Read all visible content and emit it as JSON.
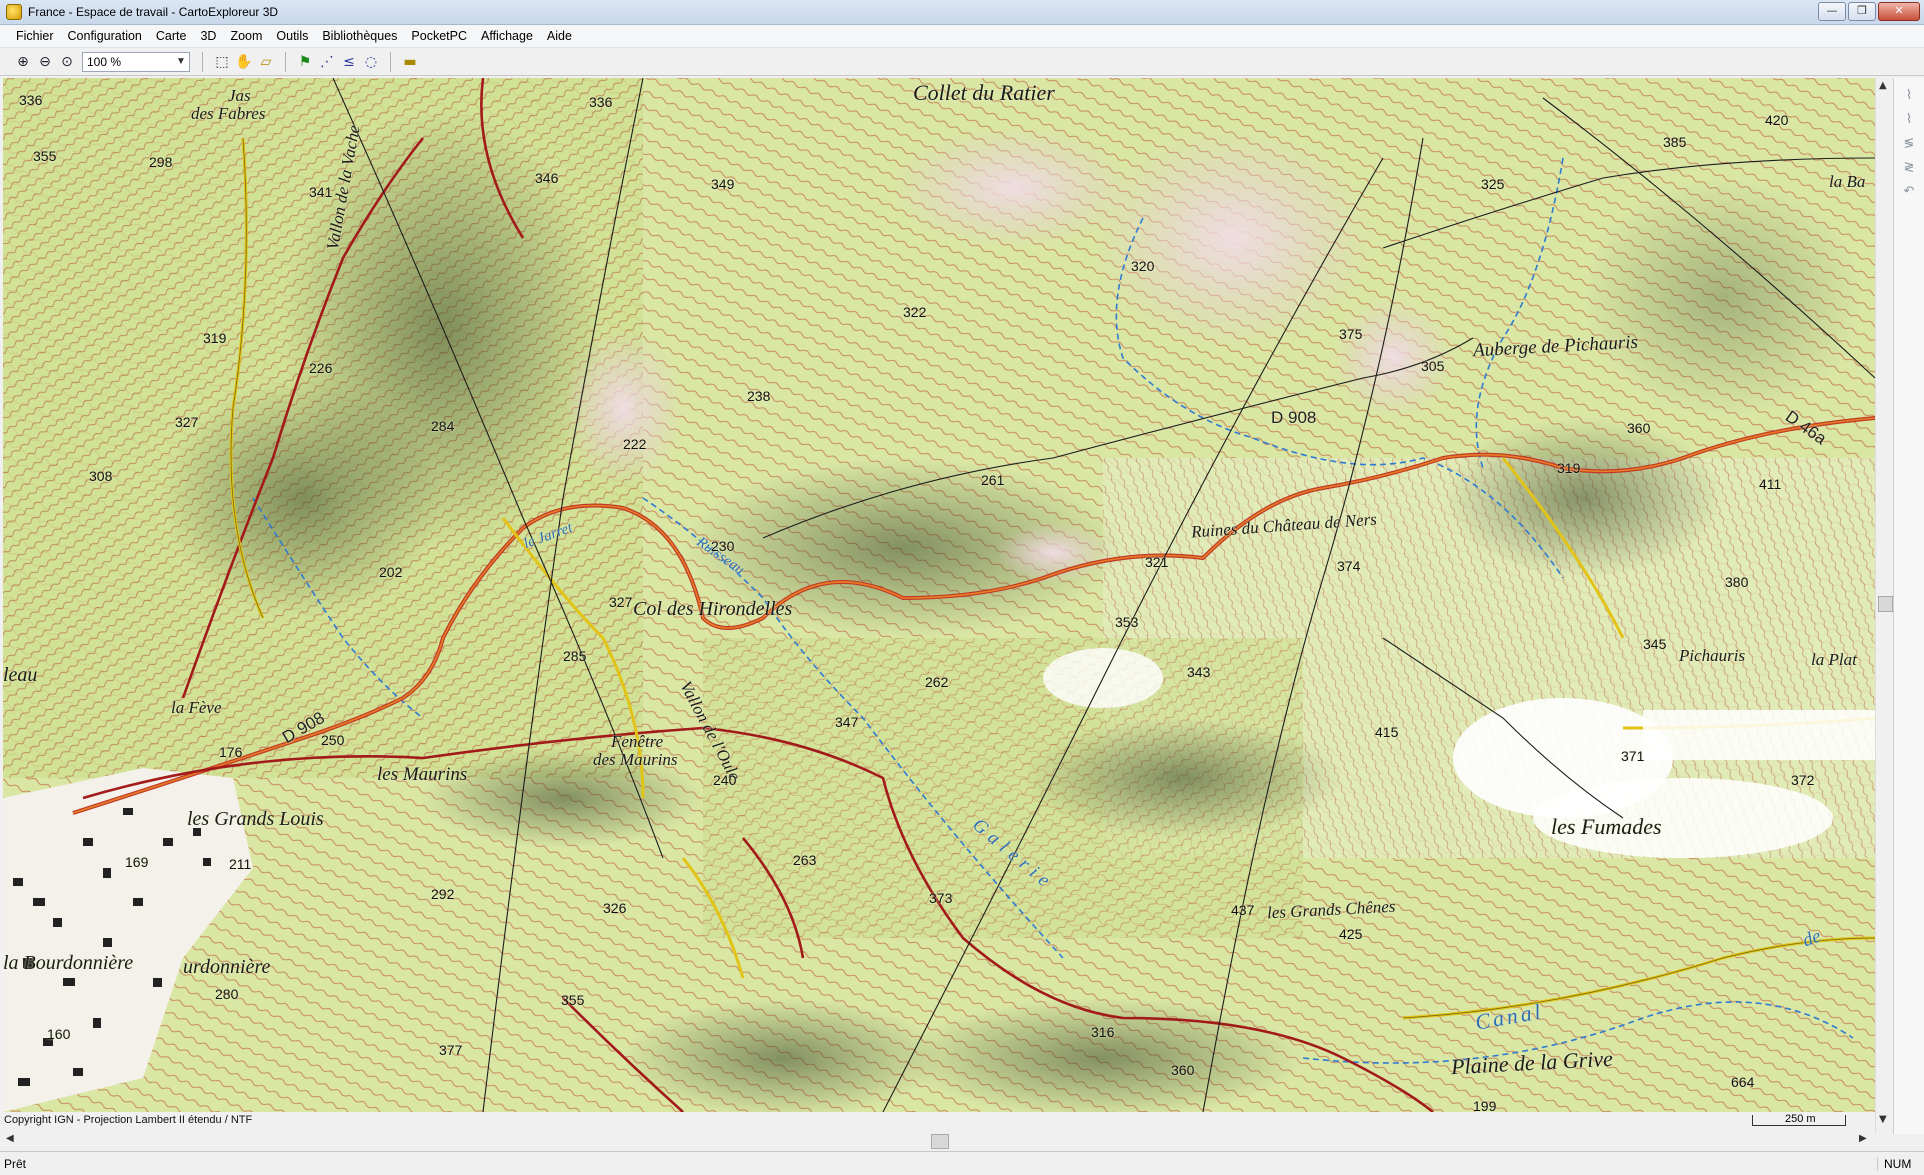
{
  "window": {
    "title": "France - Espace de travail - CartoExploreur 3D",
    "minimize": "—",
    "maximize": "❐",
    "close": "✕"
  },
  "menu": [
    "Fichier",
    "Configuration",
    "Carte",
    "3D",
    "Zoom",
    "Outils",
    "Bibliothèques",
    "PocketPC",
    "Affichage",
    "Aide"
  ],
  "toolbar": {
    "zoom_value": "100 %",
    "icons": [
      "zoom-in-icon",
      "zoom-out-icon",
      "zoom-fit-icon",
      "select-icon",
      "pan-hand-icon",
      "area-icon",
      "waypoint-flag-icon",
      "route-icon",
      "track-icon",
      "lasso-icon",
      "ruler-icon"
    ]
  },
  "map": {
    "places": {
      "collet_du_ratier": "Collet du Ratier",
      "jas_des_fabres_1": "Jas",
      "jas_des_fabres_2": "des Fabres",
      "vallon_de_la_vache": "Vallon de la Vache",
      "auberge": "Auberge de Pichauris",
      "d46a": "D 46a",
      "la_ba": "la Ba",
      "d908_east": "D 908",
      "ruines": "Ruines du Château de Ners",
      "col_des_hirondelles": "Col des Hirondelles",
      "pichauris": "Pichauris",
      "la_plat": "la Plat",
      "la_feve": "la Fève",
      "d908_west": "D 908",
      "les_maurins": "les Maurins",
      "fenetre_1": "Fenêtre",
      "fenetre_2": "des Maurins",
      "vallon_de_l_oule": "Vallon de l'Oule",
      "les_grands_louis": "les Grands Louis",
      "les_fumades": "les Fumades",
      "les_grands_chenes": "les Grands Chênes",
      "la_bourdonniere": "la Bourdonnière",
      "urdonniere": "urdonnière",
      "leau": "leau",
      "canal": "Canal",
      "plaine_de_la_grive": "Plaine de la Grive",
      "galerie": "Galerie",
      "ruisseau_1": "Ruisseau",
      "le_jarret": "le Jarret",
      "de": "de"
    },
    "elevations": [
      "336",
      "355",
      "298",
      "341",
      "346",
      "336",
      "349",
      "420",
      "385",
      "325",
      "320",
      "322",
      "319",
      "226",
      "375",
      "305",
      "327",
      "284",
      "238",
      "222",
      "360",
      "308",
      "261",
      "319",
      "411",
      "230",
      "321",
      "374",
      "380",
      "202",
      "327",
      "353",
      "345",
      "285",
      "343",
      "262",
      "347",
      "415",
      "250",
      "176",
      "371",
      "240",
      "372",
      "211",
      "169",
      "292",
      "263",
      "373",
      "326",
      "437",
      "425",
      "280",
      "355",
      "316",
      "377",
      "160",
      "360",
      "664",
      "199"
    ]
  },
  "copyright": "Copyright IGN - Projection Lambert II étendu / NTF",
  "scale_label": "250 m",
  "status": {
    "ready": "Prêt",
    "num": "NUM"
  }
}
